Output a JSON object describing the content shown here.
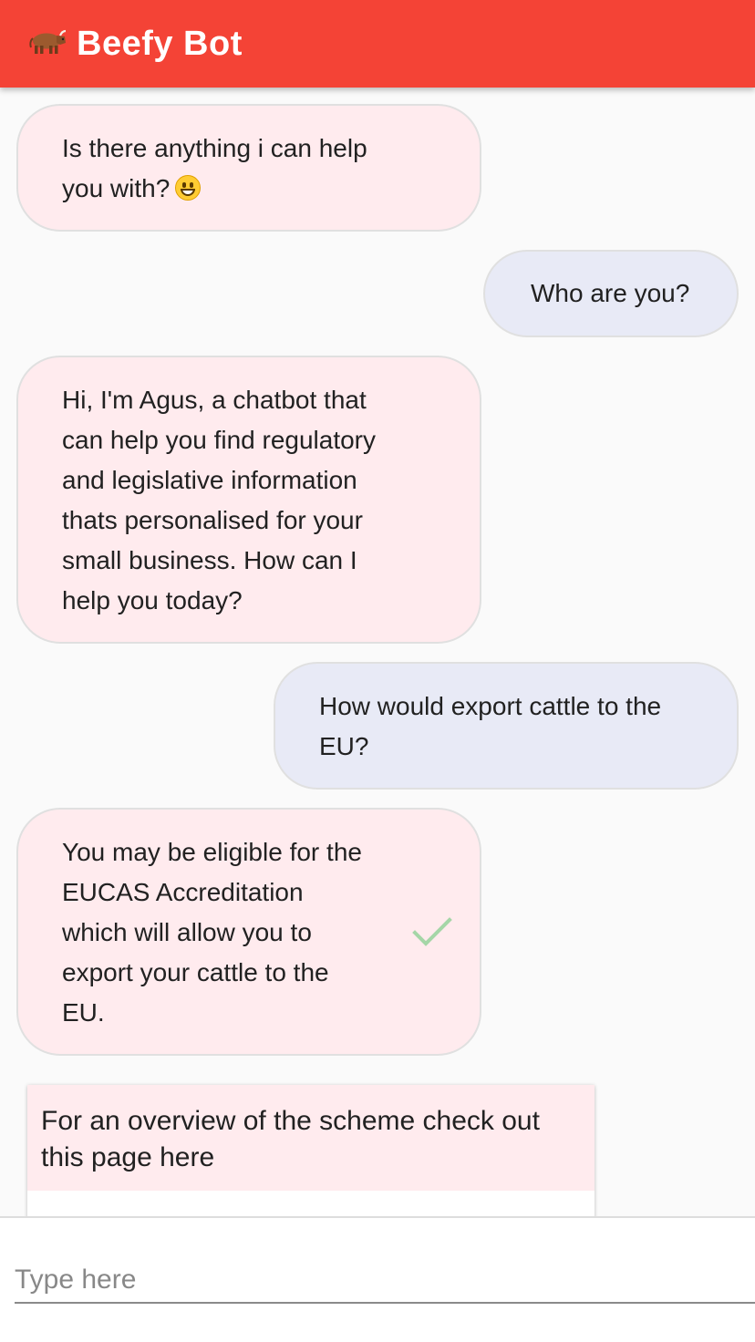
{
  "app_bar": {
    "icon": "cow-emoji",
    "title": "Beefy Bot",
    "color": "#f44336"
  },
  "messages": [
    {
      "sender": "bot",
      "lines": [
        "Is there anything i can help",
        "you with?"
      ],
      "emoji": "grinning-face"
    },
    {
      "sender": "user",
      "lines": [
        "Who are you?"
      ]
    },
    {
      "sender": "bot",
      "lines": [
        "Hi, I'm Agus, a chatbot that",
        "can help you find regulatory",
        "and legislative information",
        "thats personalised for your",
        "small business. How can I",
        "help you today?"
      ]
    },
    {
      "sender": "user",
      "lines": [
        "How would export cattle to the",
        "EU?"
      ]
    },
    {
      "sender": "bot",
      "lines": [
        "You may be eligible for the",
        "EUCAS Accreditation",
        "which will allow you to",
        "export your cattle to the",
        "EU."
      ],
      "status_icon": "check-icon"
    }
  ],
  "link_card": {
    "lines": [
      "For an overview of the scheme check out",
      "this page here"
    ]
  },
  "composer": {
    "placeholder": "Type here",
    "value": ""
  },
  "colors": {
    "bot_bubble": "#ffebee",
    "user_bubble": "#e8eaf6",
    "check": "#a5d6a7"
  }
}
